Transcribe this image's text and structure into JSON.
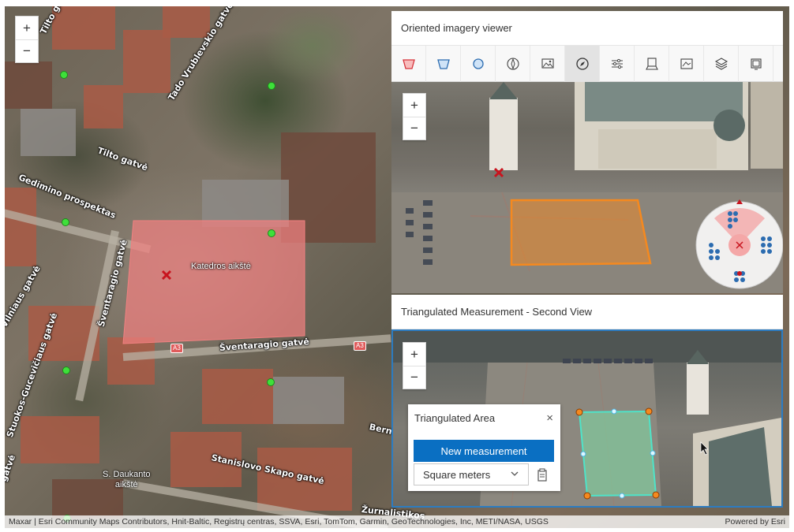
{
  "map": {
    "zoom_in": "+",
    "zoom_out": "−",
    "streets": [
      {
        "label": "Tilto gatvė"
      },
      {
        "label": "Tado Vrublevskio gatvė"
      },
      {
        "label": "Tilto gatvė"
      },
      {
        "label": "Gedimino prospektas"
      },
      {
        "label": "Šventaragio gatvė"
      },
      {
        "label": "Šventaragio gatvė"
      },
      {
        "label": "Vilniaus gatvė"
      },
      {
        "label": "Stuokos-Gucevičiaus gatvė"
      },
      {
        "label": "Stanislovo Skapo gatvė"
      },
      {
        "label": "Bern"
      },
      {
        "label": "Žurnalistikos"
      },
      {
        "label": "gatvė"
      }
    ],
    "places": {
      "cathedral_square": "Katedros aikštė",
      "daukanto_line1": "S. Daukanto",
      "daukanto_line2": "aikštė"
    },
    "route_shields": [
      "A3",
      "A3"
    ]
  },
  "attribution": {
    "sources": "Maxar | Esri Community Maps Contributors, Hnit-Baltic, Registrų centras, SSVA, Esri, TomTom, Garmin, GeoTechnologies, Inc, METI/NASA, USGS",
    "powered_by": "Powered by Esri"
  },
  "oriented_imagery": {
    "title": "Oriented imagery viewer",
    "tools": [
      {
        "icon": "image-footprint-icon"
      },
      {
        "icon": "camera-footprint-icon"
      },
      {
        "icon": "camera-location-icon"
      },
      {
        "icon": "image-orientation-icon"
      },
      {
        "icon": "image-gallery-icon"
      },
      {
        "icon": "navigation-compass-icon"
      },
      {
        "icon": "image-enhancement-icon"
      },
      {
        "icon": "map-image-to-ground-icon"
      },
      {
        "icon": "additional-overlays-icon"
      },
      {
        "icon": "layers-icon"
      },
      {
        "icon": "digitize-icon"
      }
    ],
    "active_tool_index": 5
  },
  "second_view": {
    "title": "Triangulated Measurement - Second View"
  },
  "popup": {
    "title": "Triangulated Area",
    "close": "×",
    "new_measurement": "New measurement",
    "unit": "Square meters"
  },
  "colors": {
    "accent": "#0a6fc2",
    "area_fill": "#f08080",
    "footprint": "#f5891f",
    "measurement": "#7fd0a0",
    "selection_border": "#2c7cc1",
    "graphic_points": "#3ee03a"
  }
}
